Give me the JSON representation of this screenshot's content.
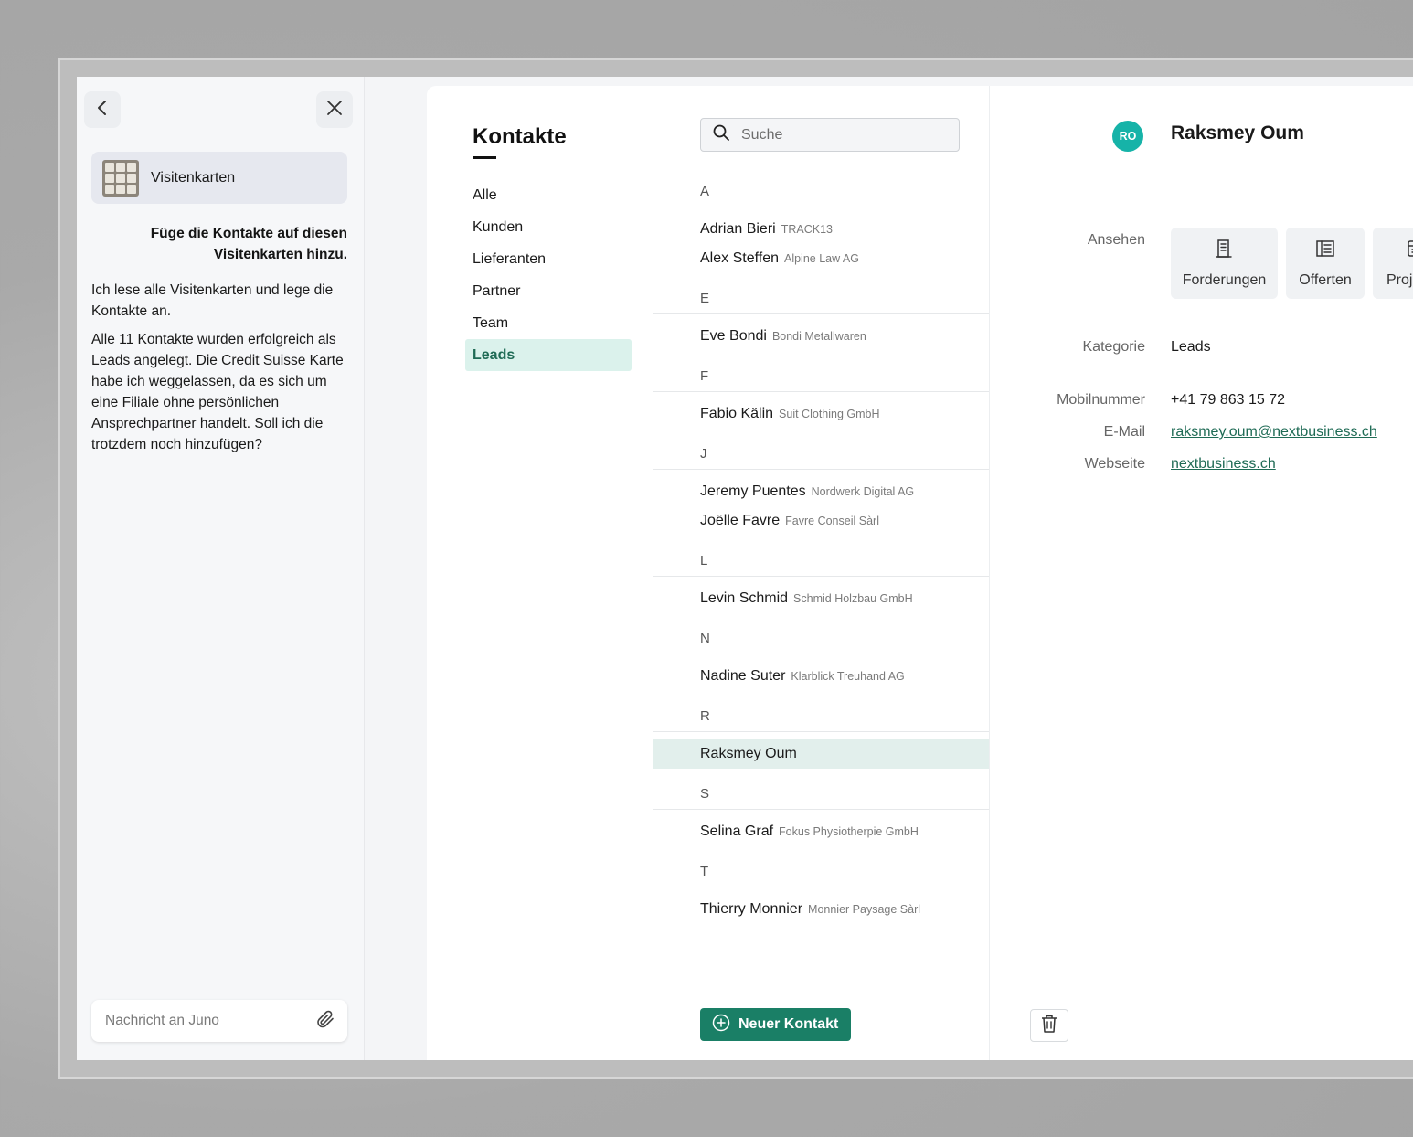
{
  "chat": {
    "attachment_name": "Visitenkarten",
    "user_message": "Füge die Kontakte auf diesen Visitenkarten hinzu.",
    "bot_messages": [
      "Ich lese alle Visitenkarten und lege die Kontakte an.",
      "Alle 11 Kontakte wurden erfolgreich als Leads angelegt. Die Credit Suisse Karte habe ich weggelassen, da es sich um eine Filiale ohne persönlichen Ansprechpartner handelt. Soll ich die trotzdem noch hinzufügen?"
    ],
    "composer_placeholder": "Nachricht an Juno",
    "icons": {
      "back": "chevron-left-icon",
      "close": "close-icon",
      "attach": "paperclip-icon"
    }
  },
  "nav": {
    "title": "Kontakte",
    "items": [
      {
        "label": "Alle"
      },
      {
        "label": "Kunden"
      },
      {
        "label": "Lieferanten"
      },
      {
        "label": "Partner"
      },
      {
        "label": "Team"
      },
      {
        "label": "Leads"
      }
    ],
    "active": "Leads"
  },
  "list": {
    "search_placeholder": "Suche",
    "groups": [
      {
        "letter": "A",
        "contacts": [
          {
            "name": "Adrian Bieri",
            "company": "TRACK13"
          },
          {
            "name": "Alex Steffen",
            "company": "Alpine Law AG"
          }
        ]
      },
      {
        "letter": "E",
        "contacts": [
          {
            "name": "Eve Bondi",
            "company": "Bondi Metallwaren"
          }
        ]
      },
      {
        "letter": "F",
        "contacts": [
          {
            "name": "Fabio Kälin",
            "company": "Suit Clothing GmbH"
          }
        ]
      },
      {
        "letter": "J",
        "contacts": [
          {
            "name": "Jeremy Puentes",
            "company": "Nordwerk Digital AG"
          },
          {
            "name": "Joëlle Favre",
            "company": "Favre Conseil Sàrl"
          }
        ]
      },
      {
        "letter": "L",
        "contacts": [
          {
            "name": "Levin Schmid",
            "company": "Schmid Holzbau GmbH"
          }
        ]
      },
      {
        "letter": "N",
        "contacts": [
          {
            "name": "Nadine Suter",
            "company": "Klarblick Treuhand AG"
          }
        ]
      },
      {
        "letter": "R",
        "contacts": [
          {
            "name": "Raksmey Oum",
            "company": "",
            "selected": true
          }
        ]
      },
      {
        "letter": "S",
        "contacts": [
          {
            "name": "Selina Graf",
            "company": "Fokus Physiotherpie GmbH"
          }
        ]
      },
      {
        "letter": "T",
        "contacts": [
          {
            "name": "Thierry Monnier",
            "company": "Monnier Paysage Sàrl"
          }
        ]
      }
    ],
    "new_contact_label": "Neuer Kontakt"
  },
  "detail": {
    "initials": "RO",
    "name": "Raksmey Oum",
    "avatar_color": "#16b3a8",
    "view_label": "Ansehen",
    "view_buttons": [
      {
        "label": "Forderungen",
        "icon": "invoice-icon"
      },
      {
        "label": "Offerten",
        "icon": "quote-icon"
      },
      {
        "label": "Proje",
        "icon": "project-icon"
      }
    ],
    "category_label": "Kategorie",
    "category": "Leads",
    "mobile_label": "Mobilnummer",
    "mobile": "+41 79 863 15 72",
    "email_label": "E-Mail",
    "email": "raksmey.oum@nextbusiness.ch",
    "website_label": "Webseite",
    "website": "nextbusiness.ch"
  },
  "colors": {
    "accent": "#1a7f66",
    "active_nav_bg": "#dbf2ec",
    "selected_row_bg": "#e2efec"
  }
}
